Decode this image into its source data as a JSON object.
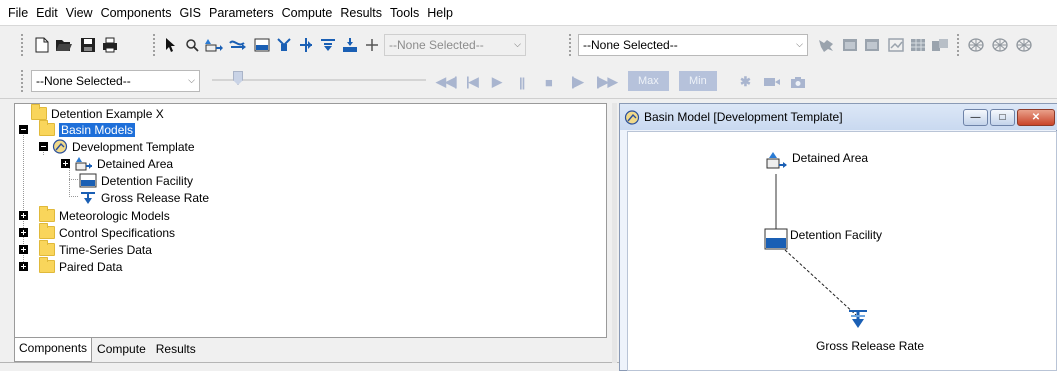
{
  "menu": [
    "File",
    "Edit",
    "View",
    "Components",
    "GIS",
    "Parameters",
    "Compute",
    "Results",
    "Tools",
    "Help"
  ],
  "toolbar": {
    "element_select": "--None Selected--",
    "basin_select": "--None Selected--",
    "run_select": "--None Selected--",
    "max_label": "Max",
    "min_label": "Min"
  },
  "tree": {
    "root": "Detention Example X",
    "basin_models": "Basin Models",
    "development_template": "Development Template",
    "detained_area": "Detained Area",
    "detention_facility": "Detention Facility",
    "gross_release_rate": "Gross Release Rate",
    "meteorologic_models": "Meteorologic Models",
    "control_specifications": "Control Specifications",
    "time_series_data": "Time-Series Data",
    "paired_data": "Paired Data"
  },
  "tabs": [
    "Components",
    "Compute",
    "Results"
  ],
  "basin_window": {
    "title": "Basin Model [Development Template]",
    "nodes": {
      "detained_area": "Detained Area",
      "detention_facility": "Detention Facility",
      "gross_release_rate": "Gross Release Rate"
    }
  },
  "colors": {
    "selection": "#1e6fd9",
    "folder": "#f9d55b",
    "window_title": "#c9d9f0"
  }
}
